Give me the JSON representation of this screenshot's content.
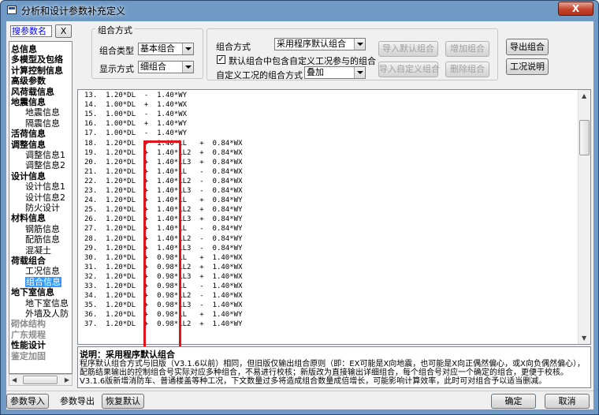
{
  "window": {
    "title": "分析和设计参数补充定义",
    "close_label": "X"
  },
  "search": {
    "value": "搜参数名",
    "clear_label": "X"
  },
  "nav": {
    "items": [
      {
        "label": "总信息",
        "level": 0
      },
      {
        "label": "多模型及包络",
        "level": 0
      },
      {
        "label": "计算控制信息",
        "level": 0
      },
      {
        "label": "高级参数",
        "level": 0
      },
      {
        "label": "风荷载信息",
        "level": 0
      },
      {
        "label": "地震信息",
        "level": 0
      },
      {
        "label": "地震信息",
        "level": 1
      },
      {
        "label": "隔震信息",
        "level": 1
      },
      {
        "label": "活荷信息",
        "level": 0
      },
      {
        "label": "调整信息",
        "level": 0
      },
      {
        "label": "调整信息1",
        "level": 1
      },
      {
        "label": "调整信息2",
        "level": 1
      },
      {
        "label": "设计信息",
        "level": 0
      },
      {
        "label": "设计信息1",
        "level": 1
      },
      {
        "label": "设计信息2",
        "level": 1
      },
      {
        "label": "防火设计",
        "level": 1
      },
      {
        "label": "材料信息",
        "level": 0
      },
      {
        "label": "钢筋信息",
        "level": 1
      },
      {
        "label": "配筋信息",
        "level": 1
      },
      {
        "label": "混凝土",
        "level": 1
      },
      {
        "label": "荷载组合",
        "level": 0
      },
      {
        "label": "工况信息",
        "level": 1
      },
      {
        "label": "组合信息",
        "level": 1,
        "selected": true
      },
      {
        "label": "地下室信息",
        "level": 0
      },
      {
        "label": "地下室信息",
        "level": 1
      },
      {
        "label": "外墙及人防",
        "level": 1
      },
      {
        "label": "砌体结构",
        "level": 0,
        "disabled": true
      },
      {
        "label": "广东规程",
        "level": 0,
        "disabled": true
      },
      {
        "label": "性能设计",
        "level": 0
      },
      {
        "label": "鉴定加固",
        "level": 0,
        "disabled": true
      }
    ]
  },
  "combo_group": {
    "title": "组合方式",
    "type_label": "组合类型",
    "type_value": "基本组合",
    "display_label": "显示方式",
    "display_value": "细组合"
  },
  "combo_method": {
    "label": "组合方式",
    "value": "采用程序默认组合",
    "checkbox_label": "默认组合中包含自定义工况参与的组合",
    "checkbox_checked": true,
    "custom_label": "自定义工况的组合方式",
    "custom_value": "叠加"
  },
  "buttons": {
    "import_default": "导入默认组合",
    "add_combo": "增加组合",
    "export_combo": "导出组合",
    "import_custom": "导入自定义组合",
    "delete_combo": "删除组合",
    "help": "工况说明",
    "param_import": "参数导入",
    "param_export": "参数导出",
    "restore_default": "恢复默认",
    "ok": "确定",
    "cancel": "取消"
  },
  "combinations": [
    "13.  1.20*DL  -  1.40*WY",
    "14.  1.00*DL  +  1.40*WX",
    "15.  1.00*DL  -  1.40*WX",
    "16.  1.00*DL  +  1.40*WY",
    "17.  1.00*DL  -  1.40*WY",
    "18.  1.20*DL  +  1.40*LL   +  0.84*WX",
    "19.  1.20*DL  +  1.40*LL2  +  0.84*WX",
    "20.  1.20*DL  +  1.40*LL3  +  0.84*WX",
    "21.  1.20*DL  +  1.40*LL   -  0.84*WX",
    "22.  1.20*DL  +  1.40*LL2  -  0.84*WX",
    "23.  1.20*DL  +  1.40*LL3  -  0.84*WX",
    "24.  1.20*DL  +  1.40*LL   +  0.84*WY",
    "25.  1.20*DL  +  1.40*LL2  +  0.84*WY",
    "26.  1.20*DL  +  1.40*LL3  +  0.84*WY",
    "27.  1.20*DL  +  1.40*LL   -  0.84*WY",
    "28.  1.20*DL  +  1.40*LL2  -  0.84*WY",
    "29.  1.20*DL  +  1.40*LL3  -  0.84*WY",
    "30.  1.20*DL  +  0.98*LL   +  1.40*WX",
    "31.  1.20*DL  +  0.98*LL2  +  1.40*WX",
    "32.  1.20*DL  +  0.98*LL3  +  1.40*WX",
    "33.  1.20*DL  +  0.98*LL   -  1.40*WX",
    "34.  1.20*DL  +  0.98*LL2  -  1.40*WX",
    "35.  1.20*DL  +  0.98*LL3  -  1.40*WX",
    "36.  1.20*DL  +  0.98*LL   +  1.40*WY",
    "37.  1.20*DL  +  0.98*LL2  +  1.40*WY"
  ],
  "description": {
    "title": "说明：采用程序默认组合",
    "text": "程序默认组合方式与旧版（V3.1.6以前）相同，但旧版仅输出组合原则（即：EX可能是X向地震，也可能是X向正偶然偏心，或X向负偶然偏心），配筋结果输出的控制组合号实际对应多种组合，不易进行校核；新版改为直接输出详细组合，每个组合号对应一个确定的组合，更便于校核。V3.1.6版新增消防车、普通楼盖等种工况，下文数量过多将造成组合数量成倍增长，可能影响计算效率，此时可对组合予以适当删减。"
  }
}
